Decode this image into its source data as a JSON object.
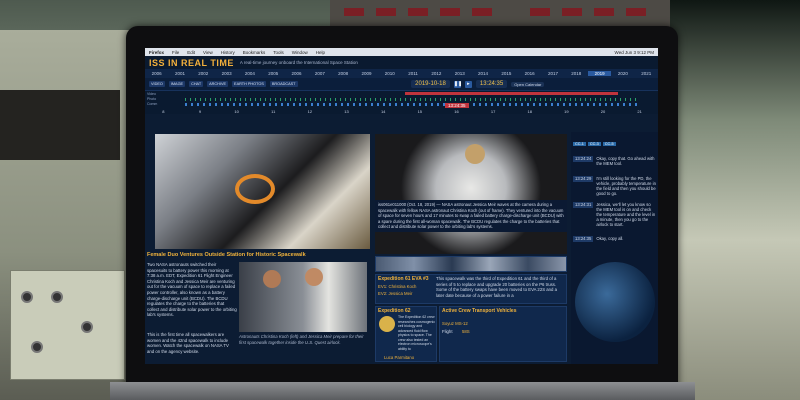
{
  "menubar": {
    "app": "Firefox",
    "items": [
      "File",
      "Edit",
      "View",
      "History",
      "Bookmarks",
      "Tools",
      "Window",
      "Help"
    ],
    "right": "Wed Jun 3 9:12 PM"
  },
  "header": {
    "logo": "ISS IN REAL TIME",
    "tagline": "A real-time journey onboard the International Space Station"
  },
  "years": [
    "2006",
    "2001",
    "2002",
    "2003",
    "2004",
    "2005",
    "2006",
    "2007",
    "2008",
    "2009",
    "2010",
    "2011",
    "2012",
    "2013",
    "2014",
    "2015",
    "2016",
    "2017",
    "2018",
    "2019",
    "2020",
    "2021"
  ],
  "active_year": "2019",
  "toolbar": {
    "buttons": [
      "VIDEO",
      "IMAGE",
      "CHAT",
      "ARCHIVE",
      "EARTH PHOTOS",
      "BROADCAST"
    ],
    "date": "2019-10-18",
    "time": "13:24:35",
    "open_calendar": "Open Calendar"
  },
  "timeline": {
    "rows": [
      "Video",
      "Photo",
      "Comm",
      "Spotlight"
    ],
    "days": [
      "8",
      "9",
      "10",
      "11",
      "12",
      "13",
      "14",
      "15",
      "16",
      "17",
      "18",
      "19",
      "20",
      "21"
    ],
    "cursor": "13:24:35"
  },
  "spacewalk_title": "Female Duo Ventures Outside Station for Historic Spacewalk",
  "spacewalk_text": "Two NASA astronauts switched their spacesuits to battery power this morning at 7:38 a.m. EDT, Expedition 61 Flight Engineer Christina Koch and Jessica Meir are venturing out for the vacuum of space to replace a failed power controller, also known as a battery charge-discharge unit (BCDU). The BCDU regulates the charge to the batteries that collect and distribute solar power to the orbiting lab's systems.",
  "spacewalk_text2": "This is the first time all spacewalkers are women and the 42nd spacewalk to include women. Watch the spacewalk on NASA TV and on the agency website.",
  "photo2_caption": "Astronauts Christina Koch (left) and Jessica Meir prepare for their first spacewalk together inside the U.S. Quest airlock.",
  "center_caption": "iss061e011000 (Oct. 18, 2019) — NASA astronaut Jessica Meir waves at the camera during a spacewalk with fellow NASA astronaut Christina Koch (out of frame). They ventured into the vacuum of space for seven hours and 17 minutes to swap a failed battery charge-discharge unit (BCDU) with a spare during the first all-woman spacewalk. The BCDU regulates the charge to the batteries that collect and distribute solar power to the orbiting lab's systems.",
  "eva": {
    "title": "Expedition 61 EVA #3",
    "ev1": "EV1: Christina Koch",
    "ev2": "EV2: Jessica Meir",
    "desc": "This spacewalk was the third of Expedition 61 and the third of a series of 5 to replace and upgrade 20 batteries on the P6 truss. Some of the battery swaps have been moved to EVA 22S and a later date because of a power failure in a"
  },
  "expedition": {
    "title": "Expedition 62",
    "text": "The Expedition 62 crew researches cosmogenic cell biology and advanced fluid flow physics to space. The crew also tested an electron microscope's ability to",
    "person": "Luca Parmitano"
  },
  "vehicles": {
    "title": "Active Crew Transport Vehicles",
    "name": "Soyuz MS-12",
    "flight": "Flight",
    "flight_num": "58S"
  },
  "chat": {
    "tags": [
      "CC-1",
      "CC-3",
      "CC-5"
    ],
    "messages": [
      {
        "time": "13:24:24",
        "text": "Okay, copy that. Go ahead with the MEM tool."
      },
      {
        "time": "13:24:29",
        "text": "I'm still looking for the PD, the vehicle, probably temperature in the field and then you should be good to go."
      },
      {
        "time": "13:24:31",
        "text": "Jessica, we'll let you know so the MEM tool is on and check the temperature and the level in a minute, then you go to the airlock to start."
      },
      {
        "time": "13:24:35",
        "text": "Okay, copy all."
      }
    ]
  }
}
